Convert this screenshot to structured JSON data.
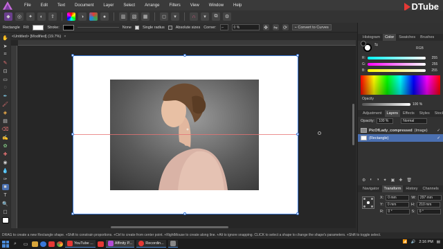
{
  "menu": [
    "File",
    "Edit",
    "Text",
    "Document",
    "Layer",
    "Select",
    "Arrange",
    "Filters",
    "View",
    "Window",
    "Help"
  ],
  "brand": "DTube",
  "context": {
    "tool": "Rectangle",
    "fill_label": "Fill:",
    "stroke_label": "Stroke:",
    "stroke_style": "None",
    "single_radius": "Single radius",
    "absolute_sizes": "Absolute sizes",
    "corner_label": "Corner:",
    "corner_value": "0 %",
    "convert": "Convert to Curves"
  },
  "doc_tab": "<Untitled> [Modified] (19.7%)",
  "doc_close": "×",
  "panel": {
    "top_tabs": [
      "Histogram",
      "Color",
      "Swatches",
      "Brushes"
    ],
    "color_mode": "RGB",
    "channels": [
      {
        "label": "R:",
        "value": "255",
        "color": "#e53935"
      },
      {
        "label": "G:",
        "value": "255",
        "color": "#43a047"
      },
      {
        "label": "B:",
        "value": "255",
        "color": "#1e88e5"
      }
    ],
    "opacity_label": "Opacity",
    "opacity_value": "100 %",
    "layer_tabs": [
      "Adjustment",
      "Layers",
      "Effects",
      "Styles",
      "Stock"
    ],
    "layer_opacity_label": "Opacity:",
    "layer_opacity": "100 %",
    "blend": "Normal",
    "layers": [
      {
        "name": "PicOfLady_compressed",
        "type": "(Image)"
      },
      {
        "name": "(Rectangle)",
        "type": ""
      }
    ],
    "transform_tabs": [
      "Navigator",
      "Transform",
      "History",
      "Channels"
    ],
    "transform": [
      {
        "label": "X:",
        "value": "0 mm",
        "label2": "W:",
        "value2": "297 mm"
      },
      {
        "label": "Y:",
        "value": "0 mm",
        "label2": "H:",
        "value2": "210 mm"
      },
      {
        "label": "R:",
        "value": "0 °",
        "label2": "S:",
        "value2": "0 °"
      }
    ]
  },
  "status": "DRAG to create a new Rectangle shape. +Shift to constrain proportions. +Ctrl to create from center point. +RightMouse to create along line. +Alt to ignore snapping. CLICK to select a shape to change the shape's parameters. +Shift to toggle select.",
  "taskbar": [
    {
      "label": "YouTube ...",
      "color": "#e53935"
    },
    {
      "label": "Affinity P...",
      "color": "#b44cd6"
    },
    {
      "label": "Recordin...",
      "color": "#e53935"
    },
    {
      "label": "",
      "color": "#888"
    }
  ],
  "clock": "2:16 PM",
  "colors": {
    "accent": "#3a78d8",
    "selection": "#4a6fb0",
    "artboard": "#ffffff"
  }
}
